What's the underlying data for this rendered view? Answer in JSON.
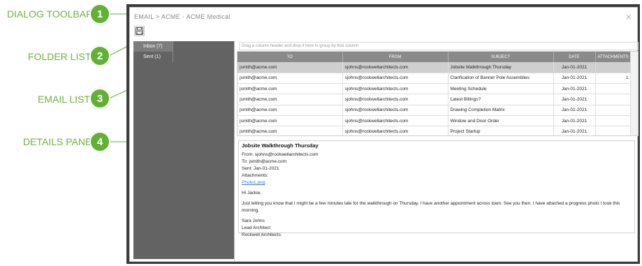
{
  "callouts": [
    {
      "num": "1",
      "label": "DIALOG TOOLBAR"
    },
    {
      "num": "2",
      "label": "FOLDER LIST"
    },
    {
      "num": "3",
      "label": "EMAIL LIST"
    },
    {
      "num": "4",
      "label": "DETAILS PANE"
    }
  ],
  "colors": {
    "callout_green": "#62b034",
    "label_green": "#6db33f",
    "folder_bg": "#636363",
    "header_bg": "#8a8a8a",
    "link": "#3a7bd5"
  },
  "dialog": {
    "title": "EMAIL  >  ACME - ACME Medical",
    "close_label": "×",
    "save_icon": "save-icon"
  },
  "folders": [
    {
      "label": "Inbox (7)",
      "active": true
    },
    {
      "label": "Sent (1)",
      "active": false
    }
  ],
  "group_bar": {
    "text": "Drag a column header and drop it here to group by that column"
  },
  "grid": {
    "columns": [
      "TO",
      "FROM",
      "SUBJECT",
      "DATE",
      "ATTACHMENTS"
    ],
    "rows": [
      {
        "to": "jsmith@acme.com",
        "from": "sjohns@rockwellarchitects.com",
        "subject": "Jobsite Walkthrough Thursday",
        "date": "Jan-01-2021",
        "attachments": ""
      },
      {
        "to": "jsmith@acme.com",
        "from": "sjohns@rockwellarchitects.com",
        "subject": "Clarification of Banner Pole Assemblies",
        "date": "Jan-01-2021",
        "attachments": "1"
      },
      {
        "to": "jsmith@acme.com",
        "from": "sjohns@rockwellarchitects.com",
        "subject": "Meeting Schedule",
        "date": "Jan-01-2021",
        "attachments": ""
      },
      {
        "to": "jsmith@acme.com",
        "from": "sjohns@rockwellarchitects.com",
        "subject": "Latest Billings?",
        "date": "Jan-01-2021",
        "attachments": ""
      },
      {
        "to": "jsmith@acme.com",
        "from": "sjohns@rockwellarchitects.com",
        "subject": "Drawing Completion Matrix",
        "date": "Jan-01-2021",
        "attachments": ""
      },
      {
        "to": "jsmith@acme.com",
        "from": "sjohns@rockwellarchitects.com",
        "subject": "Window and Door Order",
        "date": "Jan-01-2021",
        "attachments": ""
      },
      {
        "to": "jsmith@acme.com",
        "from": "sjohns@rockwellarchitects.com",
        "subject": "Project Startup",
        "date": "Jan-01-2021",
        "attachments": ""
      }
    ]
  },
  "details": {
    "subject": "Jobsite Walkthrough Thursday",
    "from": "From: sjohns@rockwellarchitects.com",
    "to": "To: jsmith@acme.com",
    "sent": "Sent: Jan-01-2021",
    "attachments_label": "Attachments:",
    "attachment_file": "Photo1.png",
    "greeting": "Hi Jackie,",
    "body": "Just letting you know that I might be a few minutes late for the walkthrough on Thursday. I have another appointment across town. See you then. I have attached a progress photo I took this morning.",
    "sig_name": "Sara Johns",
    "sig_title": "Lead Architect",
    "sig_company": "Rockwell Architects"
  }
}
